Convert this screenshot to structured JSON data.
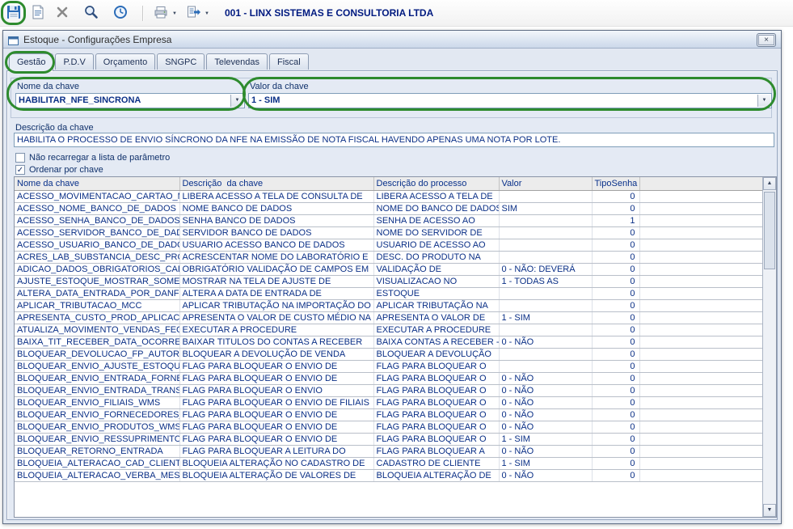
{
  "toolbar": {
    "company_label": "001 - LINX SISTEMAS E CONSULTORIA LTDA",
    "buttons": [
      {
        "name": "save",
        "icon": "floppy-disk-icon",
        "highlighted": true
      },
      {
        "name": "document",
        "icon": "document-icon"
      },
      {
        "name": "delete",
        "icon": "x-icon"
      },
      {
        "name": "search",
        "icon": "magnifier-icon"
      },
      {
        "name": "history",
        "icon": "clock-icon"
      },
      {
        "name": "print",
        "icon": "printer-icon",
        "has_dropdown": true
      },
      {
        "name": "reports",
        "icon": "report-list-icon",
        "has_dropdown": true
      }
    ]
  },
  "window": {
    "title": "Estoque - Configurações Empresa",
    "tabs": [
      {
        "label": "Gestão",
        "active": true
      },
      {
        "label": "P.D.V",
        "active": false
      },
      {
        "label": "Orçamento",
        "active": false
      },
      {
        "label": "SNGPC",
        "active": false
      },
      {
        "label": "Televendas",
        "active": false
      },
      {
        "label": "Fiscal",
        "active": false
      }
    ],
    "fields": {
      "nome_da_chave": {
        "label": "Nome da chave",
        "value": "HABILITAR_NFE_SINCRONA"
      },
      "valor_da_chave": {
        "label": "Valor da chave",
        "value": "1 - SIM"
      },
      "descricao_da_chave": {
        "label": "Descrição da chave",
        "value": "HABILITA O PROCESSO DE ENVIO SÍNCRONO DA NFE NA EMISSÃO DE NOTA FISCAL HAVENDO APENAS UMA NOTA POR LOTE."
      }
    },
    "checkboxes": [
      {
        "label": "Não recarregar a lista de parâmetro",
        "checked": false
      },
      {
        "label": "Ordenar por chave",
        "checked": true
      }
    ],
    "grid": {
      "columns": [
        "Nome da chave",
        "Descrição  da chave",
        "Descrição do processo",
        "Valor",
        "TipoSenha"
      ],
      "rows": [
        [
          "ACESSO_MOVIMENTACAO_CARTAO_M",
          "LIBERA ACESSO A TELA DE CONSULTA DE",
          "LIBERA ACESSO A TELA DE",
          "",
          "0"
        ],
        [
          "ACESSO_NOME_BANCO_DE_DADOS",
          "NOME BANCO DE DADOS",
          "NOME DO BANCO DE DADOS",
          "SIM",
          "0"
        ],
        [
          "ACESSO_SENHA_BANCO_DE_DADOS",
          "SENHA BANCO DE DADOS",
          "SENHA DE ACESSO AO",
          "",
          "1"
        ],
        [
          "ACESSO_SERVIDOR_BANCO_DE_DAD",
          "SERVIDOR BANCO DE DADOS",
          "NOME DO SERVIDOR DE",
          "",
          "0"
        ],
        [
          "ACESSO_USUARIO_BANCO_DE_DADC",
          "USUARIO ACESSO BANCO DE DADOS",
          "USUARIO DE ACESSO AO",
          "",
          "0"
        ],
        [
          "ACRES_LAB_SUBSTANCIA_DESC_PRO",
          "ACRESCENTAR NOME DO LABORATÓRIO E",
          "DESC. DO PRODUTO NA",
          "",
          "0"
        ],
        [
          "ADICAO_DADOS_OBRIGATORIOS_CAD",
          "OBRIGATÓRIO VALIDAÇÃO DE CAMPOS EM",
          "VALIDAÇÃO DE",
          "0 - NÃO: DEVERÁ",
          "0"
        ],
        [
          "AJUSTE_ESTOQUE_MOSTRAR_SOME",
          "MOSTRAR NA TELA DE AJUSTE DE",
          "VISUALIZACAO NO",
          "1 - TODAS AS",
          "0"
        ],
        [
          "ALTERA_DATA_ENTRADA_POR_DANF",
          "ALTERA A DATA DE ENTRADA DE",
          "ESTOQUE",
          "",
          "0"
        ],
        [
          "APLICAR_TRIBUTACAO_MCC",
          "APLICAR TRIBUTAÇÃO NA IMPORTAÇÃO DO",
          "APLICAR TRIBUTAÇÃO NA",
          "",
          "0"
        ],
        [
          "APRESENTA_CUSTO_PROD_APLICAC",
          "APRESENTA O VALOR DE CUSTO MÉDIO NA",
          "APRESENTA O VALOR DE",
          "1 - SIM",
          "0"
        ],
        [
          "ATUALIZA_MOVIMENTO_VENDAS_FEC",
          "EXECUTAR A PROCEDURE",
          "EXECUTAR A PROCEDURE",
          "",
          "0"
        ],
        [
          "BAIXA_TIT_RECEBER_DATA_OCORRE",
          "BAIXAR TITULOS DO CONTAS A RECEBER",
          "BAIXA CONTAS A RECEBER -",
          "0 - NÃO",
          "0"
        ],
        [
          "BLOQUEAR_DEVOLUCAO_FP_AUTORI",
          "BLOQUEAR A DEVOLUÇÃO DE VENDA",
          "BLOQUEAR A DEVOLUÇÃO",
          "",
          "0"
        ],
        [
          "BLOQUEAR_ENVIO_AJUSTE_ESTOQU",
          "FLAG PARA BLOQUEAR O ENVIO DE",
          "FLAG PARA BLOQUEAR O",
          "",
          "0"
        ],
        [
          "BLOQUEAR_ENVIO_ENTRADA_FORNE",
          "FLAG PARA BLOQUEAR O ENVIO DE",
          "FLAG PARA BLOQUEAR O",
          "0 - NÃO",
          "0"
        ],
        [
          "BLOQUEAR_ENVIO_ENTRADA_TRANS",
          "FLAG PARA BLOQUEAR O ENVIO",
          "FLAG PARA BLOQUEAR O",
          "0 - NÃO",
          "0"
        ],
        [
          "BLOQUEAR_ENVIO_FILIAIS_WMS",
          "FLAG PARA BLOQUEAR O ENVIO DE FILIAIS",
          "FLAG PARA BLOQUEAR O",
          "0 - NÃO",
          "0"
        ],
        [
          "BLOQUEAR_ENVIO_FORNECEDORES_",
          "FLAG PARA BLOQUEAR O ENVIO DE",
          "FLAG PARA BLOQUEAR O",
          "0 - NÃO",
          "0"
        ],
        [
          "BLOQUEAR_ENVIO_PRODUTOS_WMS",
          "FLAG PARA BLOQUEAR O ENVIO DE",
          "FLAG PARA BLOQUEAR O",
          "0 - NÃO",
          "0"
        ],
        [
          "BLOQUEAR_ENVIO_RESSUPRIMENTO",
          "FLAG PARA BLOQUEAR O ENVIO DE",
          "FLAG PARA BLOQUEAR O",
          "1 - SIM",
          "0"
        ],
        [
          "BLOQUEAR_RETORNO_ENTRADA",
          "FLAG PARA BLOQUEAR A LEITURA DO",
          "FLAG PARA BLOQUEAR A",
          "0 - NÃO",
          "0"
        ],
        [
          "BLOQUEIA_ALTERACAO_CAD_CLIENT",
          "BLOQUEIA ALTERAÇÃO NO CADASTRO DE",
          "CADASTRO DE CLIENTE",
          "1 - SIM",
          "0"
        ],
        [
          "BLOQUEIA_ALTERACAO_VERBA_MES",
          "BLOQUEIA ALTERAÇÃO DE VALORES DE",
          "BLOQUEIA ALTERAÇÃO DE",
          "0 - NÃO",
          "0"
        ]
      ]
    }
  },
  "colors": {
    "grid_text_navy": "#0a2f86",
    "company_navy": "#001a80",
    "annotation_green": "#2e8b2e",
    "window_bg": "#e2e8f2"
  }
}
